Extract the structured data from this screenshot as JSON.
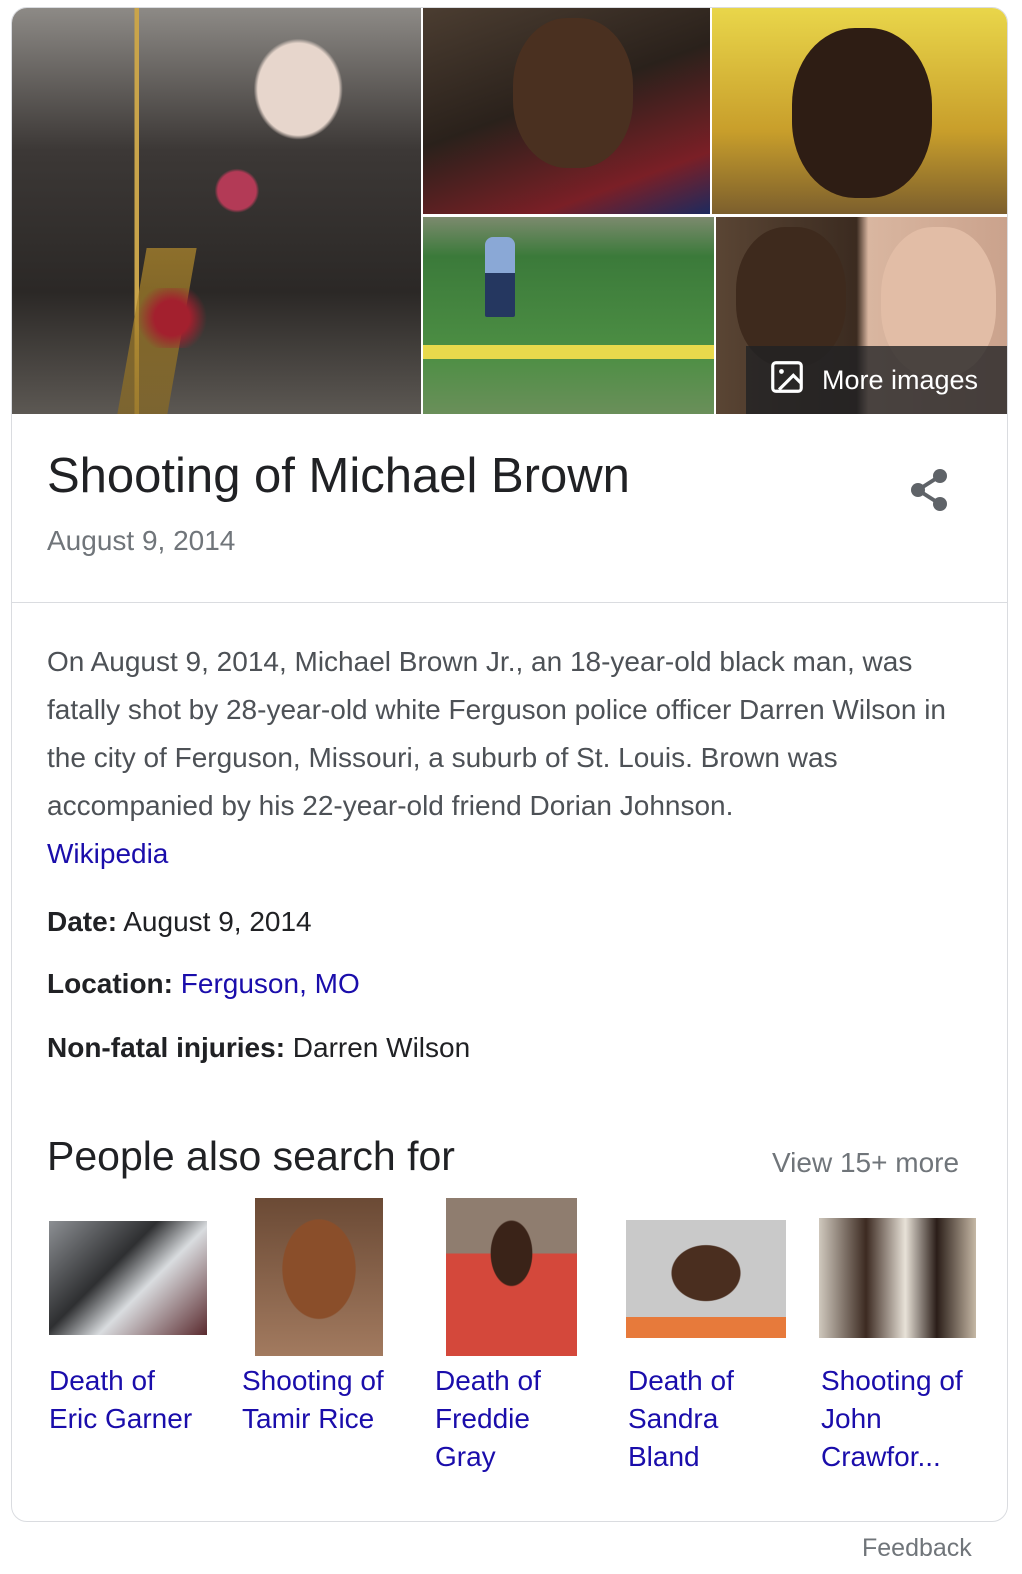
{
  "images": {
    "more_images_label": "More images"
  },
  "header": {
    "title": "Shooting of Michael Brown",
    "subtitle": "August 9, 2014"
  },
  "description": {
    "text": "On August 9, 2014, Michael Brown Jr., an 18-year-old black man, was fatally shot by 28-year-old white Ferguson police officer Darren Wilson in the city of Ferguson, Missouri, a suburb of St. Louis. Brown was accompanied by his 22-year-old friend Dorian Johnson.",
    "source_link": "Wikipedia"
  },
  "facts": [
    {
      "label": "Date:",
      "value": "August 9, 2014"
    },
    {
      "label": "Location:",
      "value": "Ferguson, MO"
    },
    {
      "label": "Non-fatal injuries:",
      "value": "Darren Wilson"
    }
  ],
  "people_also_search": {
    "title": "People also search for",
    "view_more": "View 15+ more",
    "items": [
      {
        "line1": "Death of",
        "line2": "Eric Garner",
        "line3": ""
      },
      {
        "line1": "Shooting of",
        "line2": "Tamir Rice",
        "line3": ""
      },
      {
        "line1": "Death of",
        "line2": "Freddie",
        "line3": "Gray"
      },
      {
        "line1": "Death of",
        "line2": "Sandra",
        "line3": "Bland"
      },
      {
        "line1": "Shooting of",
        "line2": "John",
        "line3": "Crawfor..."
      }
    ]
  },
  "footer": {
    "feedback": "Feedback"
  },
  "colors": {
    "link": "#1a0dab",
    "secondary_text": "#70757a",
    "primary_text": "#202124",
    "border": "#dadce0"
  }
}
